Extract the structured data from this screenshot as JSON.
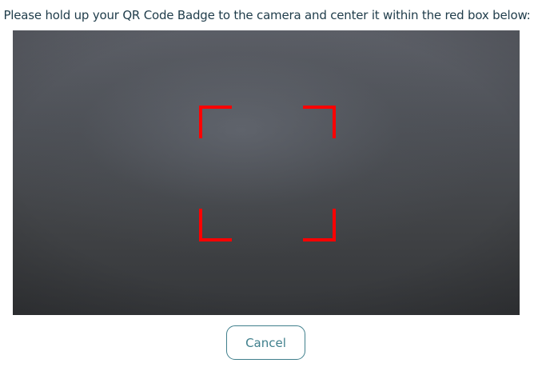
{
  "instructions": "Please hold up your QR Code Badge to the camera and center it within the red box below:",
  "camera": {
    "frame_color": "#ff0000"
  },
  "actions": {
    "cancel_label": "Cancel"
  },
  "colors": {
    "text": "#1f3c4a",
    "button_accent": "#3f7f8c"
  }
}
